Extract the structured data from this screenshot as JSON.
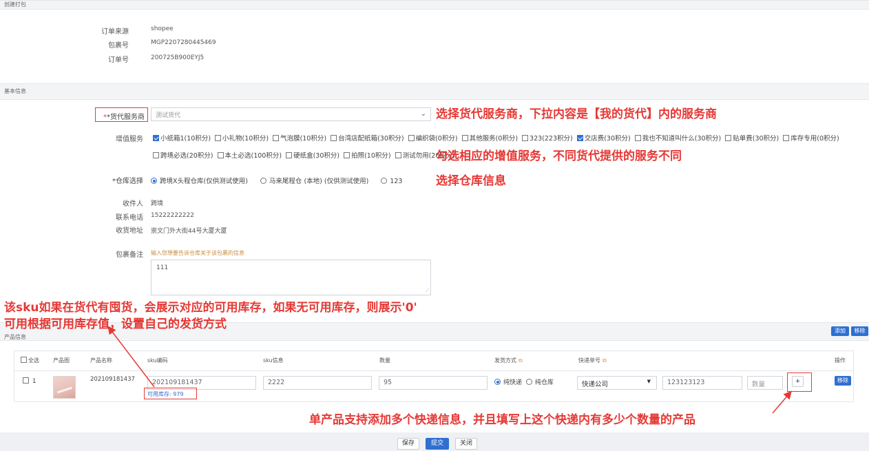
{
  "create_title": "创建打包",
  "order_info": {
    "source_label": "订单来源",
    "source_value": "shopee",
    "package_label": "包裹号",
    "package_value": "MGP2207280445469",
    "order_label": "订单号",
    "order_value": "200725B900EYJ5"
  },
  "basic_title": "基本信息",
  "forwarder": {
    "label": "*货代服务商",
    "value": "测试货代"
  },
  "value_added": {
    "label": "增值服务",
    "items": [
      {
        "label": "小纸箱1(10积分)",
        "checked": true
      },
      {
        "label": "小礼物(10积分)",
        "checked": false
      },
      {
        "label": "气泡膜(10积分)",
        "checked": false
      },
      {
        "label": "台湾店配纸箱(30积分)",
        "checked": false
      },
      {
        "label": "编织袋(0积分)",
        "checked": false
      },
      {
        "label": "其他服务(0积分)",
        "checked": false
      },
      {
        "label": "323(223积分)",
        "checked": false
      },
      {
        "label": "交店费(30积分)",
        "checked": true
      },
      {
        "label": "我也不知道叫什么(30积分)",
        "checked": false
      },
      {
        "label": "贴单费(30积分)",
        "checked": false
      },
      {
        "label": "库存专用(0积分)",
        "checked": false
      }
    ],
    "items_row2": [
      {
        "label": "跨境必选(20积分)",
        "checked": false
      },
      {
        "label": "本土必选(100积分)",
        "checked": false
      },
      {
        "label": "硬纸盒(30积分)",
        "checked": false
      },
      {
        "label": "拍照(10积分)",
        "checked": false
      },
      {
        "label": "测试勿用(20积分)",
        "checked": false
      }
    ]
  },
  "warehouse": {
    "label": "*仓库选择",
    "options": [
      {
        "label": "跨境X头程仓库(仅供测试使用)",
        "selected": true
      },
      {
        "label": "马来尾程仓 (本地) (仅供测试使用)",
        "selected": false
      },
      {
        "label": "123",
        "selected": false
      }
    ]
  },
  "recipient": {
    "name_label": "收件人",
    "name_value": "跨境",
    "phone_label": "联系电话",
    "phone_value": "15222222222",
    "address_label": "收货地址",
    "address_value": "崇文门外大街44号大厦大厦"
  },
  "remark": {
    "label": "包裹备注",
    "hint": "输入您想要告诉仓库关于该包裹的信息",
    "value": "111"
  },
  "product_title": "产品信息",
  "product_buttons": {
    "add": "添加",
    "remove": "移除"
  },
  "table": {
    "headers": {
      "select_all": "全选",
      "image": "产品图",
      "name": "产品名称",
      "sku_code": "sku编码",
      "sku_info": "sku信息",
      "qty": "数量",
      "ship_method": "发货方式",
      "tracking": "快递单号",
      "action": "操作"
    },
    "row": {
      "index": "1",
      "name": "202109181437",
      "sku_code": "202109181437",
      "stock": "可用库存: 979",
      "sku_info": "2222",
      "qty": "95",
      "ship_express": "纯快递",
      "ship_warehouse": "纯仓库",
      "courier": "快递公司",
      "tracking_no": "123123123",
      "tracking_qty_placeholder": "数量",
      "plus": "+",
      "remove": "移除"
    }
  },
  "footer": {
    "save": "保存",
    "submit": "提交",
    "close": "关闭"
  },
  "annotations": {
    "a1": "选择货代服务商，下拉内容是【我的货代】内的服务商",
    "a2": "勾选相应的增值服务，不同货代提供的服务不同",
    "a3": "选择仓库信息",
    "a4_line1": "该sku如果在货代有囤货，会展示对应的可用库存，如果无可用库存，则展示'0'",
    "a4_line2": "可用根据可用库存值，设置自己的发货方式",
    "a5": "单产品支持添加多个快递信息，并且填写上这个快递内有多少个数量的产品"
  },
  "colors": {
    "accent": "#2f6fd1",
    "annotation": "#e53935"
  }
}
